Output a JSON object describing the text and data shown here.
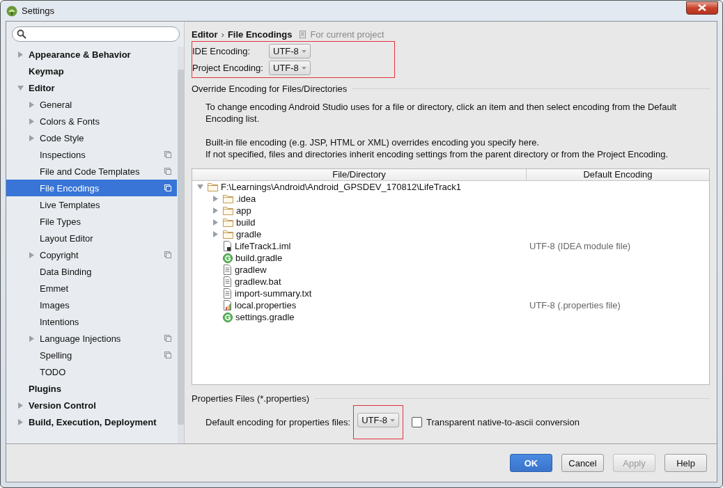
{
  "window": {
    "title": "Settings"
  },
  "sidebar": {
    "items": [
      {
        "label": "Appearance & Behavior",
        "expanded": false,
        "shared": false
      },
      {
        "label": "Keymap",
        "shared": false
      },
      {
        "label": "Editor",
        "expanded": true,
        "shared": false,
        "children": [
          {
            "label": "General",
            "expanded": false,
            "shared": false,
            "selected": false
          },
          {
            "label": "Colors & Fonts",
            "expanded": false,
            "shared": false,
            "selected": false
          },
          {
            "label": "Code Style",
            "expanded": false,
            "shared": false,
            "selected": false
          },
          {
            "label": "Inspections",
            "shared": true,
            "selected": false
          },
          {
            "label": "File and Code Templates",
            "shared": true,
            "selected": false
          },
          {
            "label": "File Encodings",
            "shared": true,
            "selected": true
          },
          {
            "label": "Live Templates",
            "shared": false,
            "selected": false
          },
          {
            "label": "File Types",
            "shared": false,
            "selected": false
          },
          {
            "label": "Layout Editor",
            "shared": false,
            "selected": false
          },
          {
            "label": "Copyright",
            "expanded": false,
            "shared": true,
            "selected": false
          },
          {
            "label": "Data Binding",
            "shared": false,
            "selected": false
          },
          {
            "label": "Emmet",
            "shared": false,
            "selected": false
          },
          {
            "label": "Images",
            "shared": false,
            "selected": false
          },
          {
            "label": "Intentions",
            "shared": false,
            "selected": false
          },
          {
            "label": "Language Injections",
            "expanded": false,
            "shared": true,
            "selected": false
          },
          {
            "label": "Spelling",
            "shared": true,
            "selected": false
          },
          {
            "label": "TODO",
            "shared": false,
            "selected": false
          }
        ]
      },
      {
        "label": "Plugins",
        "shared": false
      },
      {
        "label": "Version Control",
        "expanded": false,
        "shared": false
      },
      {
        "label": "Build, Execution, Deployment",
        "expanded": false,
        "shared": false
      }
    ]
  },
  "breadcrumb": {
    "parent": "Editor",
    "separator": "›",
    "current": "File Encodings",
    "scope": "For current project"
  },
  "encodings": {
    "highlighted": true,
    "fields": [
      {
        "label": "IDE Encoding:",
        "value": "UTF-8"
      },
      {
        "label": "Project Encoding:",
        "value": "UTF-8"
      }
    ]
  },
  "override": {
    "title": "Override Encoding for Files/Directories",
    "paragraphs": [
      [
        "To change encoding Android Studio uses for a file or directory, click an item and then select encoding from the Default Encoding list."
      ],
      [
        "Built-in file encoding (e.g. JSP, HTML or XML) overrides encoding you specify here.",
        "If not specified, files and directories inherit encoding settings from the parent directory or from the Project Encoding."
      ]
    ],
    "table": {
      "columns": [
        "File/Directory",
        "Default Encoding"
      ],
      "rows": [
        {
          "name": "F:\\Learnings\\Android\\Android_GPSDEV_170812\\LifeTrack1",
          "kind": "folder",
          "expanded": true,
          "children": [
            {
              "name": ".idea",
              "kind": "folder",
              "expanded": false
            },
            {
              "name": "app",
              "kind": "folder",
              "expanded": false
            },
            {
              "name": "build",
              "kind": "folder",
              "expanded": false
            },
            {
              "name": "gradle",
              "kind": "folder",
              "expanded": false
            },
            {
              "name": "LifeTrack1.iml",
              "kind": "module",
              "encoding": "UTF-8 (IDEA module file)"
            },
            {
              "name": "build.gradle",
              "kind": "gradle"
            },
            {
              "name": "gradlew",
              "kind": "text"
            },
            {
              "name": "gradlew.bat",
              "kind": "text"
            },
            {
              "name": "import-summary.txt",
              "kind": "text"
            },
            {
              "name": "local.properties",
              "kind": "properties",
              "encoding": "UTF-8 (.properties file)"
            },
            {
              "name": "settings.gradle",
              "kind": "gradle"
            }
          ]
        }
      ]
    }
  },
  "properties": {
    "title": "Properties Files (*.properties)",
    "label": "Default encoding for properties files:",
    "value": "UTF-8",
    "highlighted": true,
    "checkbox": {
      "label": "Transparent native-to-ascii conversion",
      "checked": false
    }
  },
  "buttons": [
    {
      "label": "OK",
      "default": true,
      "disabled": false
    },
    {
      "label": "Cancel",
      "default": false,
      "disabled": false
    },
    {
      "label": "Apply",
      "default": false,
      "disabled": true
    },
    {
      "label": "Help",
      "default": false,
      "disabled": false
    }
  ]
}
